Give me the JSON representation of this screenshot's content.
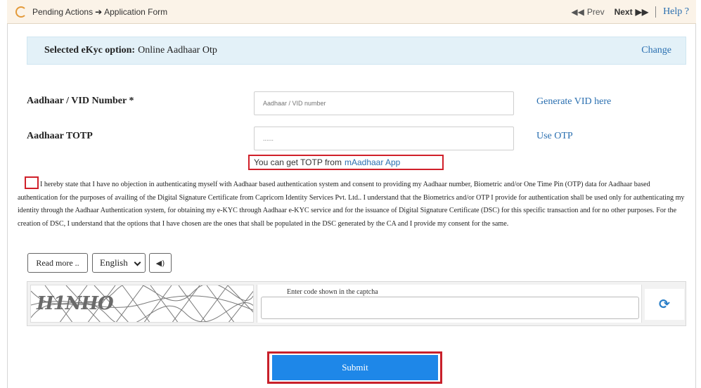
{
  "breadcrumb": {
    "part1": "Pending Actions",
    "part2": "Application Form"
  },
  "nav": {
    "prev": "Prev",
    "next": "Next",
    "help": "Help ?"
  },
  "ekyc": {
    "label": "Selected eKyc option:",
    "value": "Online Aadhaar Otp",
    "change": "Change"
  },
  "form": {
    "aadhaar_label": "Aadhaar / VID Number *",
    "aadhaar_placeholder": "Aadhaar / VID number",
    "generate_vid": "Generate VID here",
    "totp_label": "Aadhaar TOTP",
    "totp_placeholder": "......",
    "use_otp": "Use OTP",
    "hint_text": "You can get TOTP from",
    "hint_link": "mAadhaar App"
  },
  "consent": {
    "text": "I hereby state that I have no objection in authenticating myself with Aadhaar based authentication system and consent to providing my Aadhaar number, Biometric and/or One Time Pin (OTP) data for Aadhaar based authentication for the purposes of availing of the Digital Signature Certificate from Capricorn Identity Services Pvt. Ltd.. I understand that the Biometrics and/or OTP I provide for authentication shall be used only for authenticating my identity through the Aadhaar Authentication system, for obtaining my e-KYC through Aadhaar e-KYC service and for the issuance of Digital Signature Certificate (DSC) for this specific transaction and for no other purposes. For the creation of DSC, I understand that the options that I have chosen are the ones that shall be populated in the DSC generated by the CA and I provide my consent for the same."
  },
  "controls": {
    "read_more": "Read more ..",
    "language": "English"
  },
  "captcha": {
    "code": "H1NHO",
    "label": "Enter code shown in the captcha"
  },
  "submit": "Submit",
  "icons": {
    "logo": "logo-icon",
    "arrow": "arrow-right-icon",
    "prev": "double-chevron-left-icon",
    "next": "double-chevron-right-icon",
    "audio": "speaker-icon",
    "refresh": "refresh-icon"
  },
  "colors": {
    "accent_link": "#2a6fb0",
    "highlight_red": "#d0202a",
    "submit_blue": "#1e87e8",
    "banner_bg": "#e3f1f8",
    "topbar_bg": "#fbf3e8"
  }
}
